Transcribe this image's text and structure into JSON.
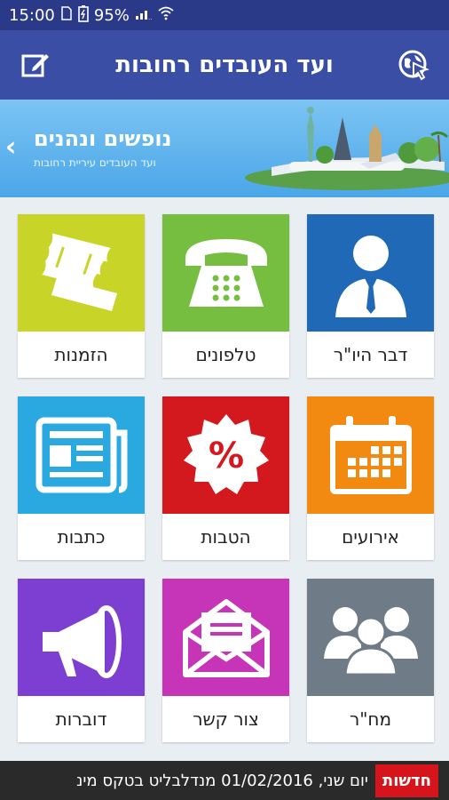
{
  "status_bar": {
    "time": "15:00",
    "battery": "95%"
  },
  "app_bar": {
    "title": "ועד העובדים רחובות",
    "left_icon": "edit-icon",
    "right_icon": "globe-cursor-icon"
  },
  "banner": {
    "title": "נופשים ונהנים",
    "subtitle": "ועד העובדים עיריית רחובות",
    "arrow": "‹"
  },
  "tiles": [
    {
      "label": "דבר היו\"ר",
      "icon": "chairman-icon",
      "color": "#1f69b7"
    },
    {
      "label": "טלפונים",
      "icon": "telephone-icon",
      "color": "#76be3f"
    },
    {
      "label": "הזמנות",
      "icon": "tickets-icon",
      "color": "#c9d428"
    },
    {
      "label": "אירועים",
      "icon": "calendar-icon",
      "color": "#f28a12"
    },
    {
      "label": "הטבות",
      "icon": "percent-badge-icon",
      "color": "#d3181e"
    },
    {
      "label": "כתבות",
      "icon": "newspaper-icon",
      "color": "#2aa9e0"
    },
    {
      "label": "מח\"ר",
      "icon": "group-icon",
      "color": "#6f7b86"
    },
    {
      "label": "צור קשר",
      "icon": "envelope-icon",
      "color": "#c634b8"
    },
    {
      "label": "דוברות",
      "icon": "megaphone-icon",
      "color": "#7c3fd1"
    }
  ],
  "news_ticker": {
    "badge": "חדשות",
    "text": "יום שני, 01/02/2016 מנדלבליט בטקס מינ"
  }
}
